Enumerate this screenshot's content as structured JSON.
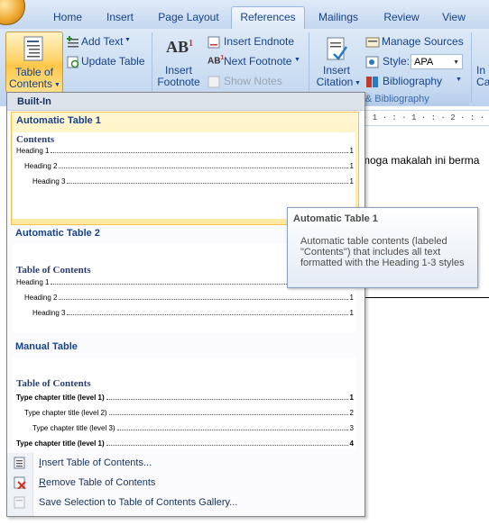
{
  "ribbon": {
    "tabs": [
      "Home",
      "Insert",
      "Page Layout",
      "References",
      "Mailings",
      "Review",
      "View"
    ],
    "active_tab": "References",
    "toc": {
      "line1": "Table of",
      "line2": "Contents"
    },
    "add_text": "Add Text",
    "update_table": "Update Table",
    "insert_footnote": {
      "line1": "Insert",
      "line2": "Footnote"
    },
    "insert_endnote": "Insert Endnote",
    "next_footnote": "Next Footnote",
    "show_notes": "Show Notes",
    "insert_citation": {
      "line1": "Insert",
      "line2": "Citation"
    },
    "manage_sources": "Manage Sources",
    "style_label": "Style:",
    "style_value": "APA",
    "bibliography": "Bibliography",
    "group_citations_label": "ns & Bibliography",
    "insert_cut": {
      "line1": "In",
      "line2": "Ca"
    }
  },
  "document": {
    "ruler": "· 1 · : · 1 · : · 2 · : · 3 · : · 4 ·",
    "text": "moga makalah ini berma"
  },
  "dropdown": {
    "section_header": "Built-In",
    "galleries": [
      {
        "title": "Automatic Table 1",
        "preview_title": "Contents",
        "lines": [
          {
            "label": "Heading 1",
            "page": "1"
          },
          {
            "label": "Heading 2",
            "page": "1"
          },
          {
            "label": "Heading 3",
            "page": "1"
          }
        ]
      },
      {
        "title": "Automatic Table 2",
        "preview_title": "Table of Contents",
        "lines": [
          {
            "label": "Heading 1",
            "page": "1"
          },
          {
            "label": "Heading 2",
            "page": "1"
          },
          {
            "label": "Heading 3",
            "page": "1"
          }
        ]
      },
      {
        "title": "Manual Table",
        "preview_title": "Table of Contents",
        "lines": [
          {
            "label": "Type chapter title (level 1)",
            "page": "1"
          },
          {
            "label": "Type chapter title (level 2)",
            "page": "2"
          },
          {
            "label": "Type chapter title (level 3)",
            "page": "3"
          },
          {
            "label": "Type chapter title (level 1)",
            "page": "4"
          }
        ]
      }
    ],
    "commands": {
      "insert": {
        "mnemonic": "I",
        "rest": "nsert Table of Contents..."
      },
      "remove": {
        "mnemonic": "R",
        "rest": "emove Table of Contents"
      },
      "save": "Save Selection to Table of Contents Gallery..."
    }
  },
  "tooltip": {
    "title": "Automatic Table 1",
    "description": "Automatic table contents (labeled \"Contents\") that includes all text formatted with the Heading 1-3 styles"
  },
  "colors": {
    "accent": "#15428b",
    "highlight": "#ffe9a0",
    "ribbon": "#c8dbf1"
  }
}
